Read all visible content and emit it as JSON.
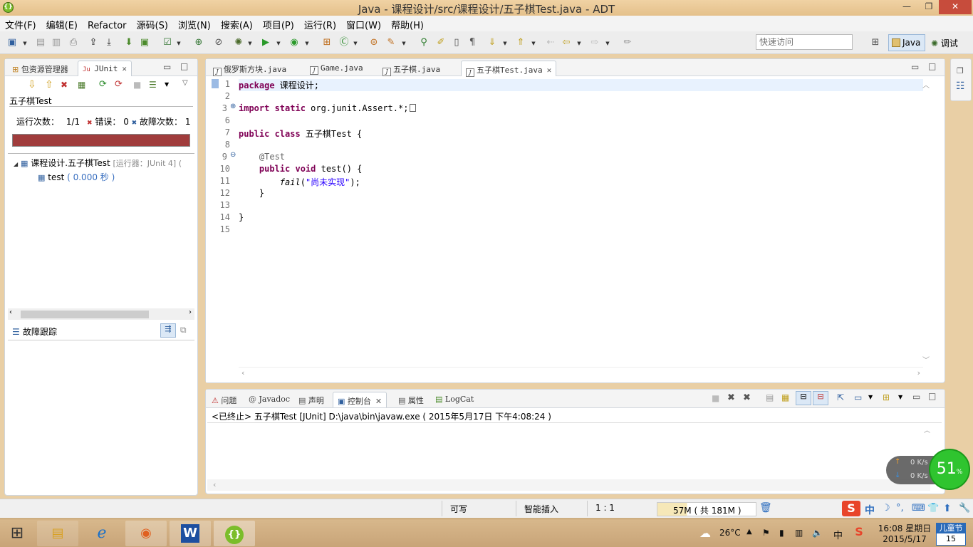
{
  "window": {
    "title": "Java - 课程设计/src/课程设计/五子棋Test.java - ADT",
    "app_icon": "{}",
    "minimize": "—",
    "restore": "❐",
    "close": "✕"
  },
  "menu": [
    "文件(F)",
    "编辑(E)",
    "Refactor",
    "源码(S)",
    "浏览(N)",
    "搜索(A)",
    "项目(P)",
    "运行(R)",
    "窗口(W)",
    "帮助(H)"
  ],
  "toolbar": {
    "quick_access_placeholder": "快速访问",
    "perspective_java": "Java",
    "perspective_debug": "调试"
  },
  "left_panel": {
    "tabs": [
      "包资源管理器",
      "JUnit"
    ],
    "title": "五子棋Test",
    "runs_label": "运行次数：",
    "runs_value": "1/1",
    "errors_label": "错误：",
    "errors_value": "0",
    "failures_label": "故障次数：",
    "failures_value": "1",
    "bar_color": "#a03c3c",
    "tree_suite": "课程设计.五子棋Test",
    "tree_suite_runner": "[运行器：JUnit 4] (",
    "tree_test": "test",
    "tree_test_time": "( 0.000 秒 )",
    "failure_trace_label": "故障跟踪"
  },
  "editor": {
    "tabs": [
      "俄罗斯方块.java",
      "Game.java",
      "五子棋.java",
      "五子棋Test.java"
    ],
    "active_tab": 3,
    "line_numbers": [
      "1",
      "2",
      "3",
      "6",
      "7",
      "8",
      "9",
      "10",
      "11",
      "12",
      "13",
      "14",
      "15"
    ],
    "lines": {
      "l1_kw": "package",
      "l1_rest": " 课程设计;",
      "l3_kw": "import static",
      "l3_rest": " org.junit.Assert.*;",
      "l7_kw": "public class",
      "l7_rest": " 五子棋Test {",
      "l9_ann": "    @Test",
      "l10_kw": "    public void",
      "l10_rest": " test() {",
      "l11_call": "        fail",
      "l11_open": "(",
      "l11_str": "\"尚未实现\"",
      "l11_close": ");",
      "l12": "    }",
      "l14": "}"
    }
  },
  "console": {
    "tabs": [
      "问题",
      "Javadoc",
      "声明",
      "控制台",
      "属性",
      "LogCat"
    ],
    "active_tab": 3,
    "header": "<已终止> 五子棋Test [JUnit] D:\\java\\bin\\javaw.exe ( 2015年5月17日 下午4:08:24 )"
  },
  "net_widget": {
    "up": "0 K/s",
    "down": "0 K/s",
    "percent": "51",
    "percent_sign": "%"
  },
  "status": {
    "writable": "可写",
    "insert_mode": "智能插入",
    "position": "1 : 1",
    "memory": "57M ( 共 181M )"
  },
  "taskbar": {
    "weather": "26°C",
    "ime": "中",
    "clock_time": "16:08 星期日",
    "clock_date": "2015/5/17",
    "calendar_label": "儿童节",
    "calendar_day": "15"
  }
}
